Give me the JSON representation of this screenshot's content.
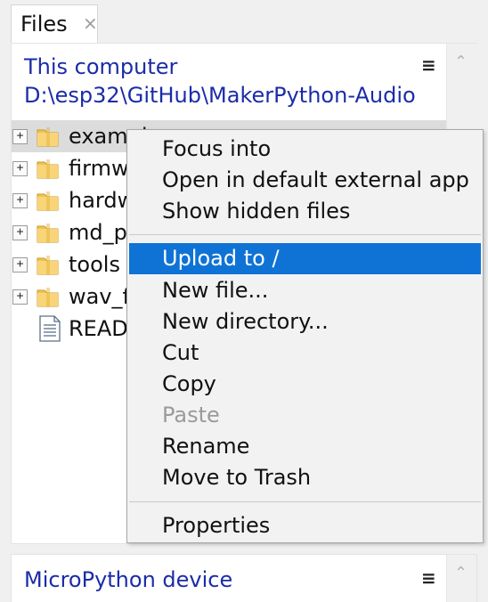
{
  "tab": {
    "label": "Files",
    "close": "×"
  },
  "local": {
    "title": "This computer",
    "path": "D:\\esp32\\GitHub\\MakerPython-Audio",
    "menu_glyph": "≡",
    "scroll_up": "⌃"
  },
  "tree": {
    "expander": "+",
    "items": [
      {
        "label": "exampl",
        "type": "folder"
      },
      {
        "label": "firmw",
        "type": "folder"
      },
      {
        "label": "hardw",
        "type": "folder"
      },
      {
        "label": "md_p",
        "type": "folder"
      },
      {
        "label": "tools",
        "type": "folder"
      },
      {
        "label": "wav_f",
        "type": "folder"
      },
      {
        "label": "READ",
        "type": "file"
      }
    ]
  },
  "context_menu": {
    "items": [
      {
        "label": "Focus into"
      },
      {
        "label": "Open in default external app"
      },
      {
        "label": "Show hidden files"
      },
      {
        "label": "Upload to /",
        "highlighted": true
      },
      {
        "label": "New file..."
      },
      {
        "label": "New directory..."
      },
      {
        "label": "Cut"
      },
      {
        "label": "Copy"
      },
      {
        "label": "Paste",
        "disabled": true
      },
      {
        "label": "Rename"
      },
      {
        "label": "Move to Trash"
      },
      {
        "label": "Properties"
      }
    ]
  },
  "device": {
    "title": "MicroPython device",
    "menu_glyph": "≡",
    "scroll_up": "⌃"
  },
  "colors": {
    "accent": "#0f73d6",
    "path_text": "#1b2ca8",
    "folder": "#f2c24f"
  }
}
